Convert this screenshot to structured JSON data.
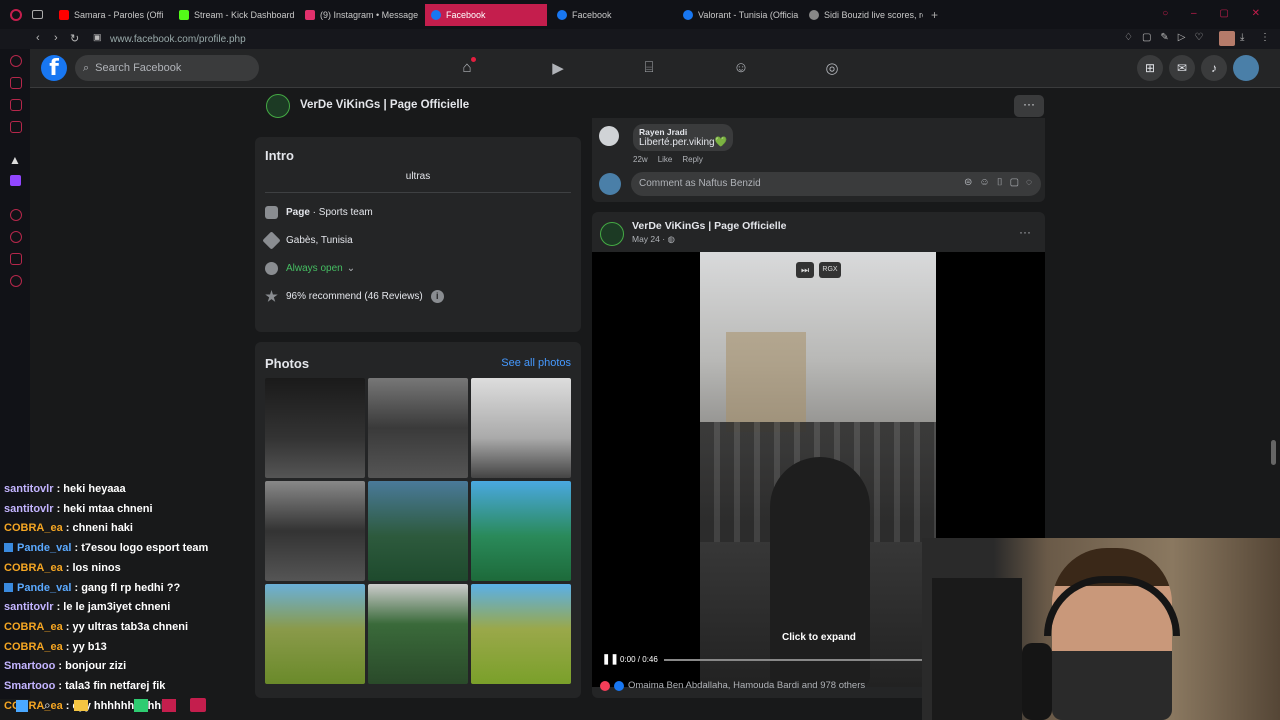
{
  "browser": {
    "tabs": [
      {
        "label": "Samara - Paroles (Offi",
        "color": "#ff0000"
      },
      {
        "label": "Stream - Kick Dashboard",
        "color": "#53fc18"
      },
      {
        "label": "(9) Instagram • Message",
        "color": "#e1306c"
      },
      {
        "label": "Facebook",
        "color": "#1877f2"
      },
      {
        "label": "Facebook",
        "color": "#1877f2"
      },
      {
        "label": "Valorant - Tunisia (Officia",
        "color": "#1877f2"
      },
      {
        "label": "Sidi Bouzid live scores, re",
        "color": "#888888"
      }
    ],
    "url": "www.facebook.com/profile.php"
  },
  "facebook": {
    "search_placeholder": "Search Facebook",
    "nav_icons": [
      "home-icon",
      "video-icon",
      "marketplace-icon",
      "groups-icon",
      "gaming-icon"
    ]
  },
  "page_header": {
    "name": "VerDe ViKinGs | Page Officielle",
    "more": "···"
  },
  "intro": {
    "title": "Intro",
    "bio": "ultras",
    "category_label": "Page",
    "category_value": " · Sports team",
    "location": "Gabès, Tunisia",
    "hours": "Always open",
    "hours_chevron": "⌄",
    "rating": "96% recommend (46 Reviews)"
  },
  "photos": {
    "title": "Photos",
    "see_all": "See all photos"
  },
  "comment": {
    "author": "Rayen Jradi",
    "text": "Liberté.per.viking💚",
    "time": "22w",
    "like": "Like",
    "reply": "Reply",
    "input_placeholder": "Comment as Naftus Benzid"
  },
  "post": {
    "author": "VerDe ViKinGs | Page Officielle",
    "date": "May 24 · ",
    "more": "···",
    "video": {
      "skip_label": "⏭",
      "quality": "RGX",
      "expand": "Click to expand",
      "time": "0:00 / 0:46",
      "progress": 0
    },
    "reactions": "Omaima Ben Abdallaha, Hamouda Bardi and 978 others"
  },
  "chat": [
    {
      "user": "santitovlr",
      "msg": " : heki heyaaa",
      "color": "#c3b4ff"
    },
    {
      "user": "santitovlr",
      "msg": " : heki mtaa chneni",
      "color": "#c3b4ff"
    },
    {
      "user": "COBRA_ea",
      "msg": " : chneni haki",
      "color": "#f5a623"
    },
    {
      "user": "Pande_val",
      "msg": " : t7esou logo esport team",
      "color": "#5aa9ff"
    },
    {
      "user": "COBRA_ea",
      "msg": " : los ninos",
      "color": "#f5a623"
    },
    {
      "user": "Pande_val",
      "msg": " : gang fl rp hedhi ??",
      "color": "#5aa9ff"
    },
    {
      "user": "santitovlr",
      "msg": " : le le jam3iyet chneni",
      "color": "#c3b4ff"
    },
    {
      "user": "COBRA_ea",
      "msg": " : yy ultras tab3a chneni",
      "color": "#f5a623"
    },
    {
      "user": "COBRA_ea",
      "msg": " : yy b13",
      "color": "#f5a623"
    },
    {
      "user": "Smartooo",
      "msg": " : bonjour zizi",
      "color": "#c3b4ff"
    },
    {
      "user": "Smartooo",
      "msg": " : tala3 fin netfarej fik",
      "color": "#c3b4ff"
    },
    {
      "user": "COBRA_ea",
      "msg": " : eyy hhhhhhhhhhh",
      "color": "#f5a623"
    }
  ]
}
